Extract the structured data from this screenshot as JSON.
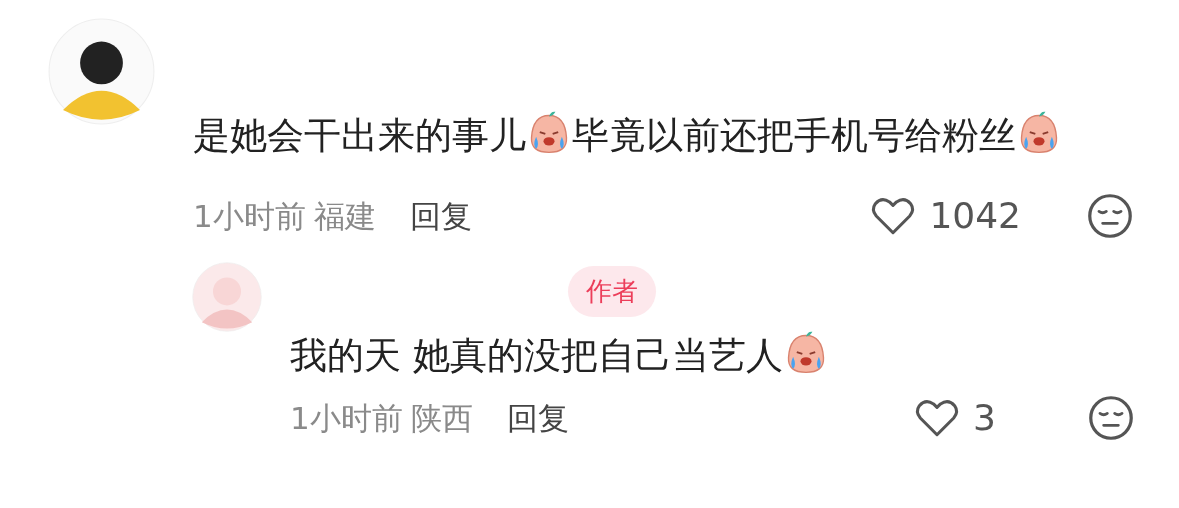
{
  "comments": [
    {
      "avatar": {
        "kind": "picture"
      },
      "content": [
        {
          "kind": "text",
          "text": "是她会干出来的事儿"
        },
        {
          "kind": "emoji"
        },
        {
          "kind": "text",
          "text": "毕竟以前还把手机号给粉丝"
        },
        {
          "kind": "emoji"
        }
      ],
      "time": "1小时前",
      "location": "福建",
      "reply_label": "回复",
      "likes": "1042",
      "replies": [
        {
          "avatar": {
            "kind": "picture"
          },
          "badge": "作者",
          "content": [
            {
              "kind": "text",
              "text": "我的天 她真的没把自己当艺人"
            },
            {
              "kind": "emoji"
            }
          ],
          "time": "1小时前",
          "location": "陕西",
          "reply_label": "回复",
          "likes": "3"
        }
      ]
    }
  ]
}
